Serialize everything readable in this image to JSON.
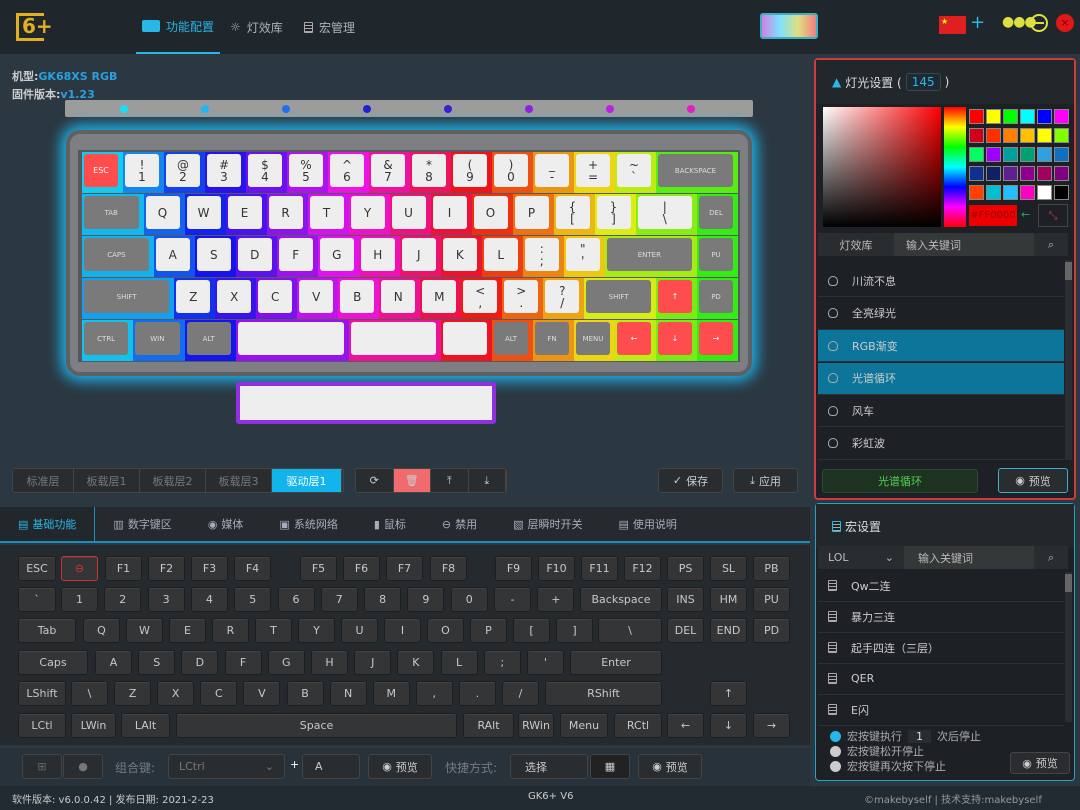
{
  "app": {
    "logo_text": "6+",
    "tabs": [
      {
        "label": "功能配置",
        "icon": "keyboard-icon"
      },
      {
        "label": "灯效库",
        "icon": "bulb-icon"
      },
      {
        "label": "宏管理",
        "icon": "document-icon"
      }
    ],
    "language_flag": "china-flag-icon",
    "add": "+"
  },
  "device": {
    "model_label": "机型:",
    "model": "GK68XS RGB",
    "firmware_label": "固件版本:",
    "firmware": "v1.23"
  },
  "led_colors": [
    "#19e0f0",
    "#20b8f0",
    "#2070f0",
    "#2020d0",
    "#3820d0",
    "#9020e0",
    "#c020e0",
    "#e020c0"
  ],
  "visual_keyboard": [
    [
      [
        "ESC"
      ],
      [
        "!",
        "1"
      ],
      [
        "@",
        "2"
      ],
      [
        "#",
        "3"
      ],
      [
        "$",
        "4"
      ],
      [
        "%",
        "5"
      ],
      [
        "^",
        "6"
      ],
      [
        "&",
        "7"
      ],
      [
        "*",
        "8"
      ],
      [
        "(",
        "9"
      ],
      [
        ")",
        "0"
      ],
      [
        "_",
        "-"
      ],
      [
        "+",
        "="
      ],
      [
        "~",
        "`"
      ],
      [
        "BACKSPACE"
      ]
    ],
    [
      [
        "TAB"
      ],
      [
        "Q"
      ],
      [
        "W"
      ],
      [
        "E"
      ],
      [
        "R"
      ],
      [
        "T"
      ],
      [
        "Y"
      ],
      [
        "U"
      ],
      [
        "I"
      ],
      [
        "O"
      ],
      [
        "P"
      ],
      [
        "{",
        "["
      ],
      [
        "}",
        "]"
      ],
      [
        "|",
        "\\"
      ],
      [
        "DEL"
      ]
    ],
    [
      [
        "CAPS"
      ],
      [
        "A"
      ],
      [
        "S"
      ],
      [
        "D"
      ],
      [
        "F"
      ],
      [
        "G"
      ],
      [
        "H"
      ],
      [
        "J"
      ],
      [
        "K"
      ],
      [
        "L"
      ],
      [
        ":",
        ";"
      ],
      [
        "\"",
        "'"
      ],
      [
        "ENTER"
      ],
      [
        "PU"
      ]
    ],
    [
      [
        "SHIFT"
      ],
      [
        "Z"
      ],
      [
        "X"
      ],
      [
        "C"
      ],
      [
        "V"
      ],
      [
        "B"
      ],
      [
        "N"
      ],
      [
        "M"
      ],
      [
        "<",
        ","
      ],
      [
        ">",
        "."
      ],
      [
        "?",
        "/"
      ],
      [
        "SHIFT"
      ],
      [
        "↑"
      ],
      [
        "PD"
      ]
    ],
    [
      [
        "CTRL"
      ],
      [
        "WIN"
      ],
      [
        "ALT"
      ],
      [
        ""
      ],
      [
        ""
      ],
      [
        ""
      ],
      [
        "ALT"
      ],
      [
        "FN"
      ],
      [
        "MENU"
      ],
      [
        "←"
      ],
      [
        "↓"
      ],
      [
        "→"
      ]
    ]
  ],
  "layers": {
    "items": [
      "标准层",
      "板载层1",
      "板载层2",
      "板载层3",
      "驱动层1"
    ],
    "active": 4
  },
  "layer_actions": [
    "refresh-icon",
    "delete-icon",
    "upload-icon",
    "download-icon"
  ],
  "save_label": "保存",
  "apply_label": "应用",
  "func_tabs": {
    "items": [
      "基础功能",
      "数字键区",
      "媒体",
      "系统网络",
      "鼠标",
      "禁用",
      "层瞬时开关",
      "使用说明"
    ],
    "active": 0
  },
  "vkeys": [
    [
      "ESC",
      "⊖",
      "F1",
      "F2",
      "F3",
      "F4",
      "F5",
      "F6",
      "F7",
      "F8",
      "F9",
      "F10",
      "F11",
      "F12",
      "PS",
      "SL",
      "PB"
    ],
    [
      "`",
      "1",
      "2",
      "3",
      "4",
      "5",
      "6",
      "7",
      "8",
      "9",
      "0",
      "-",
      "+",
      "Backspace",
      "INS",
      "HM",
      "PU"
    ],
    [
      "Tab",
      "Q",
      "W",
      "E",
      "R",
      "T",
      "Y",
      "U",
      "I",
      "O",
      "P",
      "[",
      "]",
      "\\",
      "DEL",
      "END",
      "PD"
    ],
    [
      "Caps",
      "A",
      "S",
      "D",
      "F",
      "G",
      "H",
      "J",
      "K",
      "L",
      ";",
      "'",
      "Enter"
    ],
    [
      "LShift",
      "\\",
      "Z",
      "X",
      "C",
      "V",
      "B",
      "N",
      "M",
      ",",
      ".",
      "/",
      "RShift",
      "↑"
    ],
    [
      "LCtl",
      "LWin",
      "LAlt",
      "Space",
      "RAlt",
      "RWin",
      "Menu",
      "RCtl",
      "←",
      "↓",
      "→"
    ]
  ],
  "bottom": {
    "combo_label": "组合键:",
    "modifier": "LCtrl",
    "plus": "+",
    "key": "A",
    "preview": "预览",
    "shortcut_label": "快捷方式:",
    "shortcut_value": "选择"
  },
  "status": {
    "left": "软件版本: v6.0.0.42 | 发布日期: 2021-2-23",
    "center": "GK6+ V6",
    "right": "©makebyself | 技术支持:makebyself"
  },
  "light": {
    "title": "灯光设置 (",
    "count": "145",
    "close": ")",
    "hex": "#FF0000",
    "swatches": [
      "#ff0000",
      "#ffff00",
      "#00ff00",
      "#00ffff",
      "#0000ff",
      "#ff00ff",
      "#d0001a",
      "#ff3000",
      "#ff8000",
      "#ffc000",
      "#ffff00",
      "#80ff00",
      "#00ff60",
      "#a000ff",
      "#00a0a0",
      "#00a070",
      "#30a0e0",
      "#1070c0",
      "#103090",
      "#102060",
      "#602090",
      "#900090",
      "#a00060",
      "#800080",
      "#ff4000",
      "#00c0d0",
      "#20c0ff",
      "#ff00c0",
      "#ffffff",
      "#000000"
    ],
    "lib_tab": "灯效库",
    "search_placeholder": "输入关键词",
    "effects": [
      "川流不息",
      "全亮绿光",
      "RGB渐变",
      "光谱循环",
      "风车",
      "彩虹波"
    ],
    "selected": [
      2,
      3
    ],
    "current": "光谱循环",
    "preview": "预览"
  },
  "macro": {
    "title": "宏设置",
    "group": "LOL",
    "search_placeholder": "输入关键词",
    "items": [
      "Qw二连",
      "暴力三连",
      "起手四连（三层）",
      "QER",
      "E闪"
    ],
    "options": [
      {
        "label": "宏按键执行",
        "count": "1",
        "suffix": "次后停止",
        "checked": true
      },
      {
        "label": "宏按键松开停止",
        "checked": false
      },
      {
        "label": "宏按键再次按下停止",
        "checked": false
      }
    ],
    "preview": "预览"
  }
}
